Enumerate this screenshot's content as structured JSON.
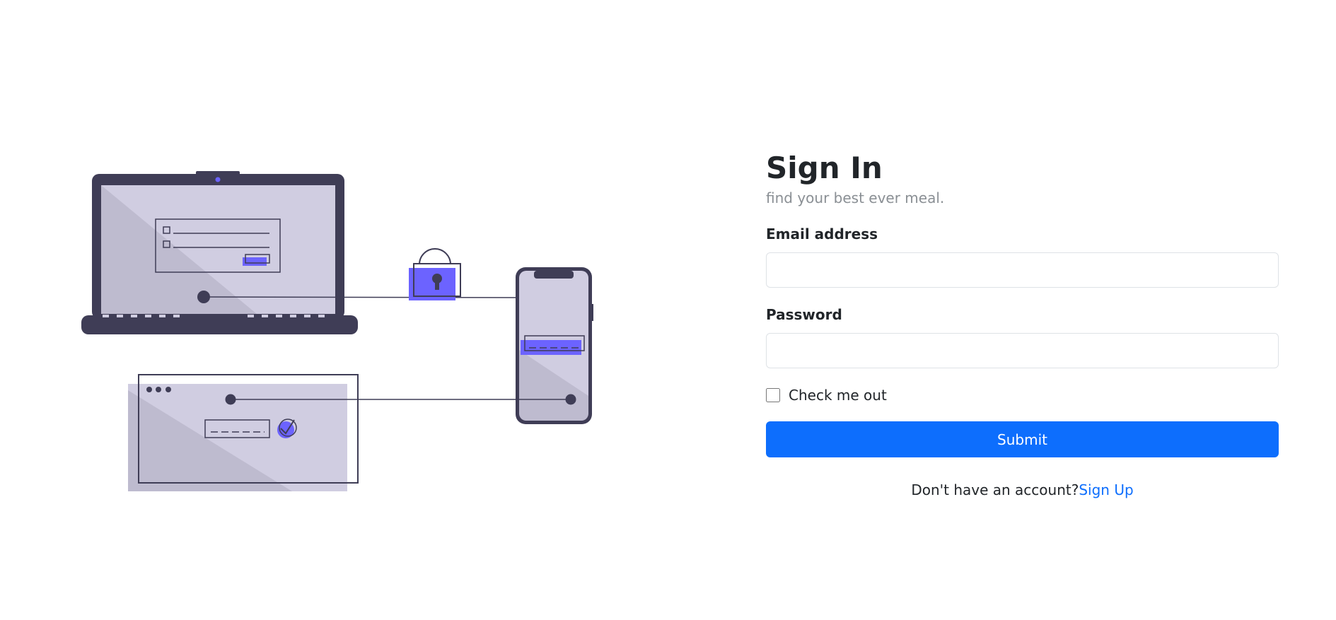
{
  "colors": {
    "accent": "#0d6efd",
    "illustration_accent": "#6c63ff",
    "illustration_dark": "#3f3d56",
    "illustration_light": "#d0cde1"
  },
  "login": {
    "title": "Sign In",
    "subtitle": "find your best ever meal.",
    "email_label": "Email address",
    "email_value": "",
    "password_label": "Password",
    "password_value": "",
    "checkbox_label": "Check me out",
    "checkbox_checked": false,
    "submit_label": "Submit",
    "footer_text": "Don't have an account?",
    "signup_label": "Sign Up"
  },
  "illustration": {
    "icons": [
      "laptop-icon",
      "lock-icon",
      "phone-icon",
      "browser-window-icon",
      "checkmark-icon"
    ]
  }
}
